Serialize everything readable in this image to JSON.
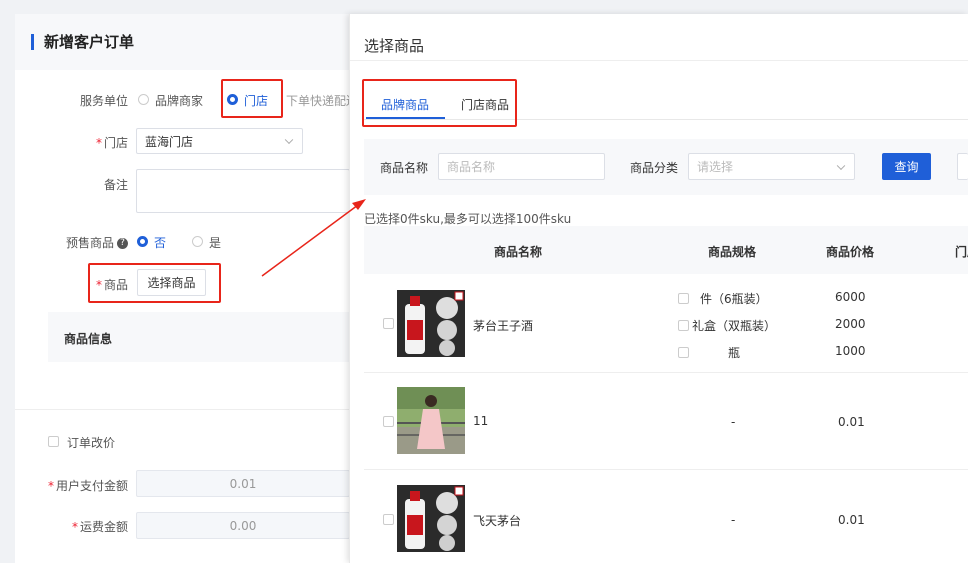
{
  "form": {
    "title": "新增客户订单",
    "service_unit_label": "服务单位",
    "service_options": [
      "品牌商家",
      "门店"
    ],
    "service_hint": "下单快递配送",
    "store_label": "门店",
    "store_value": "蓝海门店",
    "remark_label": "备注",
    "presale_label": "预售商品",
    "presale_help": "?",
    "presale_options": [
      "否",
      "是"
    ],
    "goods_label": "商品",
    "select_goods_button": "选择商品",
    "goods_info_title": "商品信息",
    "price_change_label": "订单改价",
    "pay_amount_label": "用户支付金额",
    "pay_amount_value": "0.01",
    "shipping_label": "运费金额",
    "shipping_value": "0.00",
    "required_mark": "*"
  },
  "modal": {
    "title": "选择商品",
    "tabs": [
      "品牌商品",
      "门店商品"
    ],
    "filter": {
      "name_label": "商品名称",
      "name_placeholder": "商品名称",
      "category_label": "商品分类",
      "category_placeholder": "请选择",
      "query_button": "查询"
    },
    "selection_note": "已选择0件sku,最多可以选择100件sku",
    "columns": [
      "商品名称",
      "商品规格",
      "商品价格",
      "门店"
    ],
    "rows": [
      {
        "name": "茅台王子酒",
        "specs": [
          "件（6瓶装）",
          "礼盒（双瓶装）",
          "瓶"
        ],
        "prices": [
          "6000",
          "2000",
          "1000"
        ]
      },
      {
        "name": "11",
        "specs": [
          "-"
        ],
        "prices": [
          "0.01"
        ]
      },
      {
        "name": "飞天茅台",
        "specs": [
          "-"
        ],
        "prices": [
          "0.01"
        ]
      }
    ]
  },
  "colors": {
    "accent": "#1f5fd8",
    "highlight": "#e8251a"
  }
}
